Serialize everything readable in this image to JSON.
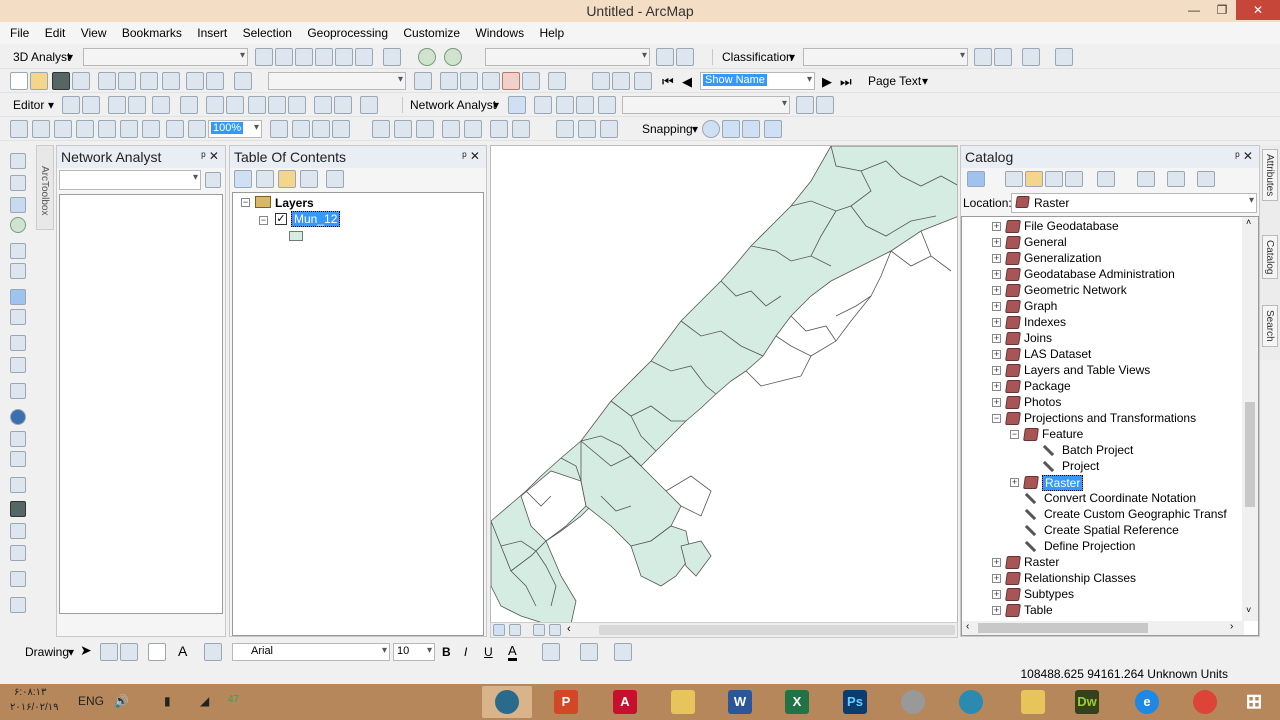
{
  "window": {
    "title": "Untitled - ArcMap"
  },
  "menu": [
    "File",
    "Edit",
    "View",
    "Bookmarks",
    "Insert",
    "Selection",
    "Geoprocessing",
    "Customize",
    "Windows",
    "Help"
  ],
  "toolbar1": {
    "analyst": "3D Analyst",
    "classification": "Classification"
  },
  "toolbar2": {
    "show_name": "Show Name",
    "page_text": "Page Text"
  },
  "toolbar3": {
    "editor": "Editor",
    "network_analyst": "Network Analyst"
  },
  "toolbar4": {
    "zoom_pct": "100%",
    "snapping": "Snapping"
  },
  "arctoolbox": "ArcToolbox",
  "network_panel": {
    "title": "Network Analyst"
  },
  "toc": {
    "title": "Table Of Contents",
    "root": "Layers",
    "layer": "Mun_12"
  },
  "catalog": {
    "title": "Catalog",
    "location_label": "Location:",
    "location_value": "Raster",
    "items": [
      {
        "label": "File Geodatabase",
        "type": "box",
        "level": 0,
        "expander": "+"
      },
      {
        "label": "General",
        "type": "box",
        "level": 0,
        "expander": "+"
      },
      {
        "label": "Generalization",
        "type": "box",
        "level": 0,
        "expander": "+"
      },
      {
        "label": "Geodatabase Administration",
        "type": "box",
        "level": 0,
        "expander": "+"
      },
      {
        "label": "Geometric Network",
        "type": "box",
        "level": 0,
        "expander": "+"
      },
      {
        "label": "Graph",
        "type": "box",
        "level": 0,
        "expander": "+"
      },
      {
        "label": "Indexes",
        "type": "box",
        "level": 0,
        "expander": "+"
      },
      {
        "label": "Joins",
        "type": "box",
        "level": 0,
        "expander": "+"
      },
      {
        "label": "LAS Dataset",
        "type": "box",
        "level": 0,
        "expander": "+"
      },
      {
        "label": "Layers and Table Views",
        "type": "box",
        "level": 0,
        "expander": "+"
      },
      {
        "label": "Package",
        "type": "box",
        "level": 0,
        "expander": "+"
      },
      {
        "label": "Photos",
        "type": "box",
        "level": 0,
        "expander": "+"
      },
      {
        "label": "Projections and Transformations",
        "type": "box",
        "level": 0,
        "expander": "-"
      },
      {
        "label": "Feature",
        "type": "box",
        "level": 1,
        "expander": "-"
      },
      {
        "label": "Batch Project",
        "type": "tool",
        "level": 2,
        "expander": ""
      },
      {
        "label": "Project",
        "type": "tool",
        "level": 2,
        "expander": ""
      },
      {
        "label": "Raster",
        "type": "box",
        "level": 1,
        "expander": "+",
        "selected": true
      },
      {
        "label": "Convert Coordinate Notation",
        "type": "tool",
        "level": 1,
        "expander": ""
      },
      {
        "label": "Create Custom Geographic Transf",
        "type": "tool",
        "level": 1,
        "expander": ""
      },
      {
        "label": "Create Spatial Reference",
        "type": "tool",
        "level": 1,
        "expander": ""
      },
      {
        "label": "Define Projection",
        "type": "tool",
        "level": 1,
        "expander": ""
      },
      {
        "label": "Raster",
        "type": "box",
        "level": 0,
        "expander": "+"
      },
      {
        "label": "Relationship Classes",
        "type": "box",
        "level": 0,
        "expander": "+"
      },
      {
        "label": "Subtypes",
        "type": "box",
        "level": 0,
        "expander": "+"
      },
      {
        "label": "Table",
        "type": "box",
        "level": 0,
        "expander": "+"
      }
    ]
  },
  "sidetabs": [
    "Attributes",
    "Catalog",
    "Search"
  ],
  "drawbar": {
    "drawing": "Drawing",
    "font": "Arial",
    "size": "10",
    "bold": "B",
    "italic": "I",
    "underline": "U"
  },
  "status": {
    "coords": "108488.625  94161.264 Unknown Units"
  },
  "taskbar": {
    "lang": "ENG",
    "clock_time": "۶:۰۸:۱۳",
    "clock_date": "۲۰۱۶/۰۲/۱۹",
    "battery": "47"
  },
  "colors": {
    "polygon_fill": "#d4ece1",
    "titlebar": "#f3ddc4",
    "taskbar": "#b5875a",
    "selection": "#3399ff"
  }
}
